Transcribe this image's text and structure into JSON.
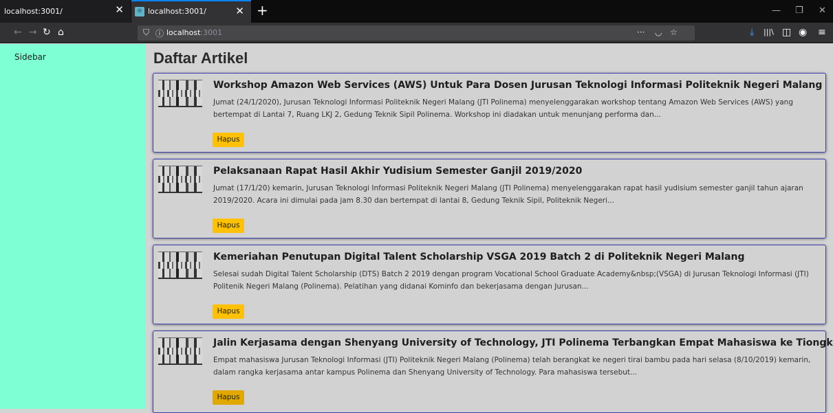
{
  "browser": {
    "tabs": [
      {
        "title": "localhost:3001/",
        "close": "✕"
      },
      {
        "title": "localhost:3001/",
        "close": "✕"
      }
    ],
    "new_tab": "+",
    "window": {
      "minimize": "—",
      "restore": "❐",
      "close": "✕"
    },
    "nav": {
      "back": "←",
      "forward": "→",
      "reload": "↻",
      "home": "⌂"
    },
    "url": {
      "host": "localhost",
      "port": ":3001"
    },
    "url_actions": {
      "more": "···",
      "pocket": "◡",
      "bookmark": "☆"
    },
    "toolbar": {
      "download": "⤓",
      "library": "|||\\",
      "sidebar": "◫",
      "account": "◉",
      "menu": "≡"
    }
  },
  "sidebar": {
    "label": "Sidebar"
  },
  "page": {
    "title": "Daftar Artikel"
  },
  "articles": [
    {
      "title": "Workshop Amazon Web Services (AWS) Untuk Para Dosen Jurusan Teknologi Informasi Politeknik Negeri Malang",
      "description": "Jumat (24/1/2020), Jurusan Teknologi Informasi Politeknik Negeri Malang (JTI Polinema) menyelenggarakan workshop tentang Amazon Web Services (AWS) yang bertempat di Lantai 7, Ruang LKJ 2, Gedung Teknik Sipil Polinema. Workshop ini diadakan untuk menunjang performa dan...",
      "button": "Hapus"
    },
    {
      "title": "Pelaksanaan Rapat Hasil Akhir Yudisium Semester Ganjil 2019/2020",
      "description": "Jumat (17/1/20) kemarin, Jurusan Teknologi Informasi Politeknik Negeri Malang (JTI Polinema) menyelenggarakan rapat hasil yudisium semester ganjil tahun ajaran 2019/2020. Acara ini dimulai pada jam 8.30 dan bertempat di lantai 8, Gedung Teknik Sipil, Politeknik Negeri...",
      "button": "Hapus"
    },
    {
      "title": "Kemeriahan Penutupan Digital Talent Scholarship VSGA 2019 Batch 2 di Politeknik Negeri Malang",
      "description": "Selesai sudah Digital Talent Scholarship (DTS) Batch 2 2019 dengan program Vocational School Graduate Academy&nbsp;(VSGA) di Jurusan Teknologi Informasi (JTI) Politenik Negeri Malang (Polinema). Pelatihan yang didanai Kominfo dan bekerjasama dengan Jurusan...",
      "button": "Hapus"
    },
    {
      "title": "Jalin Kerjasama dengan Shenyang University of Technology, JTI Polinema Terbangkan Empat Mahasiswa ke Tiongkok",
      "description": "Empat mahasiswa Jurusan Teknologi Informasi (JTI) Politeknik Negeri Malang (Polinema) telah berangkat ke negeri tirai bambu pada hari selasa (8/10/2019) kemarin, dalam rangka kerjasama antar kampus Polinema dan Shenyang University of Technology. Para mahasiswa tersebut...",
      "button": "Hapus"
    }
  ]
}
